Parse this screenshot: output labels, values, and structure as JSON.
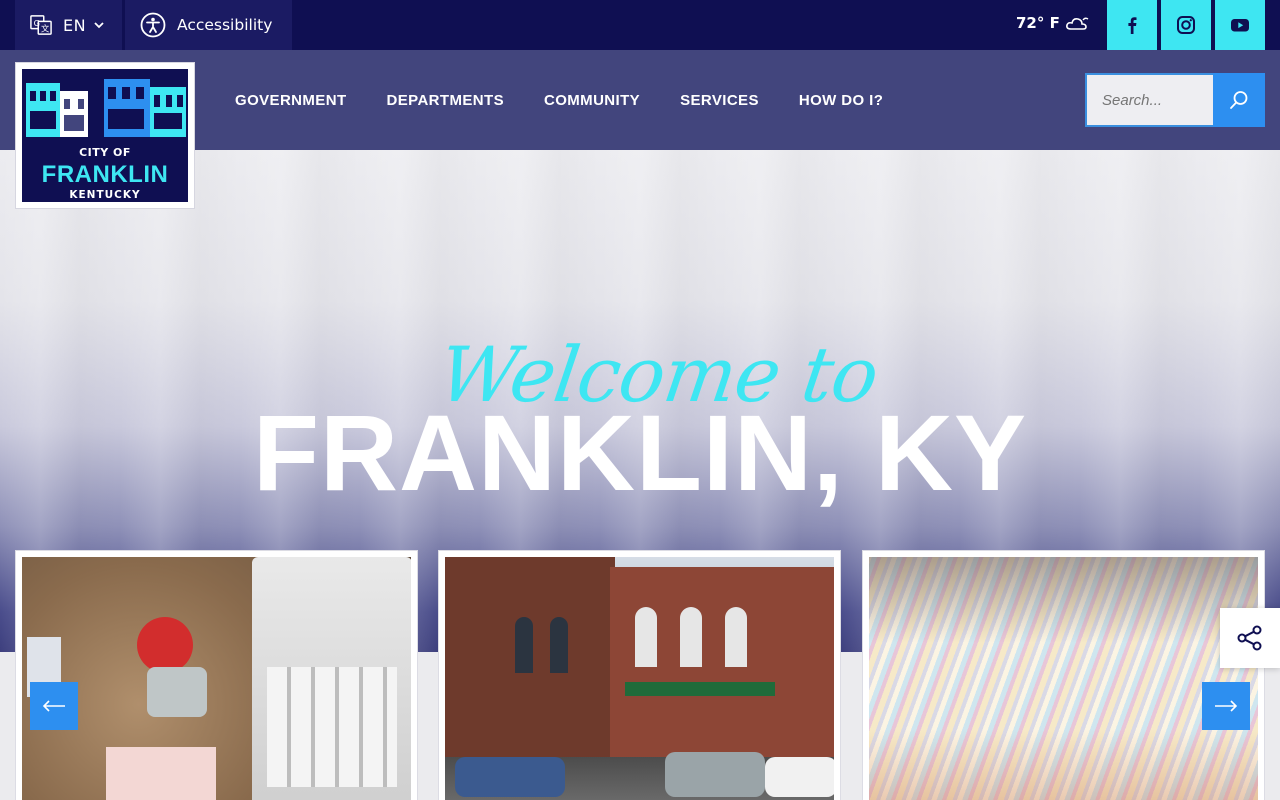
{
  "topbar": {
    "language": "EN",
    "accessibility_label": "Accessibility",
    "weather": "72° F"
  },
  "logo": {
    "line1": "CITY OF",
    "line2": "FRANKLIN",
    "line3": "KENTUCKY"
  },
  "nav": {
    "items": [
      "GOVERNMENT",
      "DEPARTMENTS",
      "COMMUNITY",
      "SERVICES",
      "HOW DO I?"
    ]
  },
  "search": {
    "placeholder": "Search..."
  },
  "hero": {
    "script_text": "Welcome to",
    "headline": "FRANKLIN, KY"
  },
  "colors": {
    "navy": "#0f0f52",
    "nav_blue": "#42457d",
    "cyan": "#3ee6f2",
    "accent_blue": "#2d8ff0"
  },
  "icons": {
    "social": [
      "facebook-icon",
      "instagram-icon",
      "youtube-icon"
    ]
  }
}
